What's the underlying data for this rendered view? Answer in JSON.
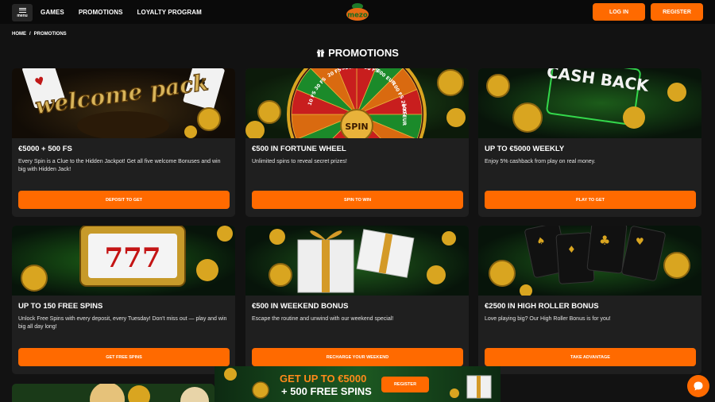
{
  "header": {
    "menu_label": "menu",
    "nav": [
      "GAMES",
      "PROMOTIONS",
      "LOYALTY PROGRAM"
    ],
    "logo_text": "mezo",
    "login_label": "LOG IN",
    "register_label": "REGISTER"
  },
  "breadcrumb": {
    "home": "HOME",
    "separator": "/",
    "current": "PROMOTIONS"
  },
  "page_title": "PROMOTIONS",
  "cards": [
    {
      "title": "€5000 + 500 FS",
      "desc": "Every Spin is a Clue to the Hidden Jackpot! Get all five welcome Bonuses and win big with Hidden Jack!",
      "button": "DEPOSIT TO GET",
      "art": "welcome pack"
    },
    {
      "title": "€500 IN FORTUNE WHEEL",
      "desc": "Unlimited spins to reveal secret prizes!",
      "button": "SPIN TO WIN",
      "art": "SPIN"
    },
    {
      "title": "UP TO €5000 WEEKLY",
      "desc": "Enjoy 5% cashback from play on real money.",
      "button": "PLAY TO GET",
      "art": "CASH BACK"
    },
    {
      "title": "UP TO 150 FREE SPINS",
      "desc": "Unlock Free Spins with every deposit, every Tuesday! Don't miss out — play and win big all day long!",
      "button": "GET FREE SPINS",
      "art": "777"
    },
    {
      "title": "€500 IN WEEKEND BONUS",
      "desc": "Escape the routine and unwind with our weekend special!",
      "button": "RECHARGE YOUR WEEKEND",
      "art": ""
    },
    {
      "title": "€2500 IN HIGH ROLLER BONUS",
      "desc": "Love playing big? Our High Roller Bonus is for you!",
      "button": "TAKE ADVANTAGE",
      "art": ""
    }
  ],
  "wheel_labels": [
    "30 FS",
    "20 FS",
    "SECRET",
    "150 FS",
    "500 EUR",
    "100 FS",
    "10 FS",
    "100 EUR",
    "20 FS"
  ],
  "banner": {
    "line1": "GET UP TO €5000",
    "line2": "+ 500 FREE SPINS",
    "button": "REGISTER"
  },
  "colors": {
    "accent": "#ff6a00",
    "background": "#121212",
    "card": "#1f1f1f"
  },
  "icons": [
    "menu-icon",
    "gift-icon",
    "chat-icon"
  ]
}
